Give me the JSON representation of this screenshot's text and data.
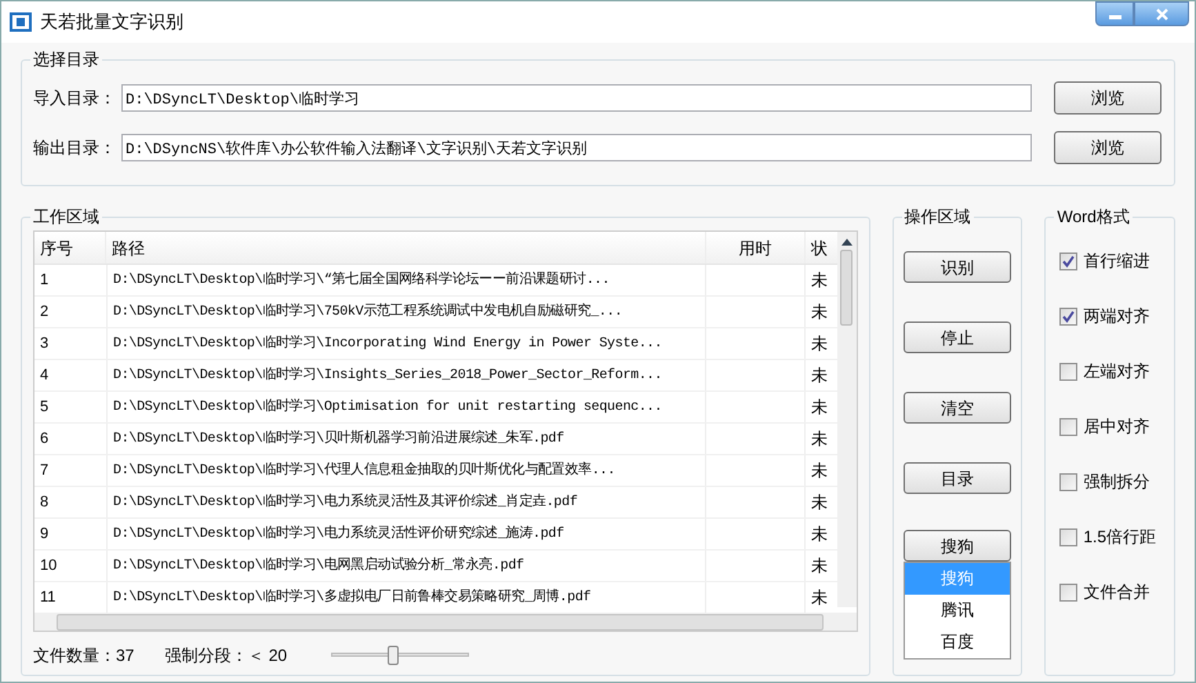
{
  "window": {
    "title": "天若批量文字识别"
  },
  "directory_group": {
    "title": "选择目录",
    "fields": [
      {
        "label": "导入目录：",
        "value": "D:\\DSyncLT\\Desktop\\临时学习",
        "button": "浏览"
      },
      {
        "label": "输出目录：",
        "value": "D:\\DSyncNS\\软件库\\办公软件输入法翻译\\文字识别\\天若文字识别",
        "button": "浏览"
      }
    ]
  },
  "work_area": {
    "title": "工作区域",
    "table": {
      "columns": [
        "序号",
        "路径",
        "用时",
        "状"
      ],
      "rows": [
        {
          "index": "1",
          "path": "D:\\DSyncLT\\Desktop\\临时学习\\“第七届全国网络科学论坛ーー前沿课题研讨...",
          "time": "",
          "status": "未"
        },
        {
          "index": "2",
          "path": "D:\\DSyncLT\\Desktop\\临时学习\\750kV示范工程系统调试中发电机自励磁研究_...",
          "time": "",
          "status": "未"
        },
        {
          "index": "3",
          "path": "D:\\DSyncLT\\Desktop\\临时学习\\Incorporating Wind Energy in Power Syste...",
          "time": "",
          "status": "未"
        },
        {
          "index": "4",
          "path": "D:\\DSyncLT\\Desktop\\临时学习\\Insights_Series_2018_Power_Sector_Reform...",
          "time": "",
          "status": "未"
        },
        {
          "index": "5",
          "path": "D:\\DSyncLT\\Desktop\\临时学习\\Optimisation for unit restarting sequenc...",
          "time": "",
          "status": "未"
        },
        {
          "index": "6",
          "path": "D:\\DSyncLT\\Desktop\\临时学习\\贝叶斯机器学习前沿进展综述_朱军.pdf",
          "time": "",
          "status": "未"
        },
        {
          "index": "7",
          "path": "D:\\DSyncLT\\Desktop\\临时学习\\代理人信息租金抽取的贝叶斯优化与配置效率...",
          "time": "",
          "status": "未"
        },
        {
          "index": "8",
          "path": "D:\\DSyncLT\\Desktop\\临时学习\\电力系统灵活性及其评价综述_肖定垚.pdf",
          "time": "",
          "status": "未"
        },
        {
          "index": "9",
          "path": "D:\\DSyncLT\\Desktop\\临时学习\\电力系统灵活性评价研究综述_施涛.pdf",
          "time": "",
          "status": "未"
        },
        {
          "index": "10",
          "path": "D:\\DSyncLT\\Desktop\\临时学习\\电网黑启动试验分析_常永亮.pdf",
          "time": "",
          "status": "未"
        },
        {
          "index": "11",
          "path": "D:\\DSyncLT\\Desktop\\临时学习\\多虚拟电厂日前鲁棒交易策略研究_周博.pdf",
          "time": "",
          "status": "未"
        }
      ]
    },
    "file_count": "文件数量：37",
    "split_label": "强制分段：＜ 20",
    "split_slider": {
      "level": 0.45
    }
  },
  "operations": {
    "title": "操作区域",
    "buttons": [
      "识别",
      "停止",
      "清空",
      "目录"
    ],
    "engine": {
      "value": "搜狗",
      "options": [
        {
          "label": "搜狗",
          "selected": true
        },
        {
          "label": "腾讯",
          "selected": false
        },
        {
          "label": "百度",
          "selected": false
        }
      ]
    }
  },
  "word_format": {
    "title": "Word格式",
    "options": [
      {
        "label": "首行缩进",
        "checked": true
      },
      {
        "label": "两端对齐",
        "checked": true
      },
      {
        "label": "左端对齐",
        "checked": false
      },
      {
        "label": "居中对齐",
        "checked": false
      },
      {
        "label": "强制拆分",
        "checked": false
      },
      {
        "label": "1.5倍行距",
        "checked": false
      },
      {
        "label": "文件合并",
        "checked": false
      }
    ]
  }
}
